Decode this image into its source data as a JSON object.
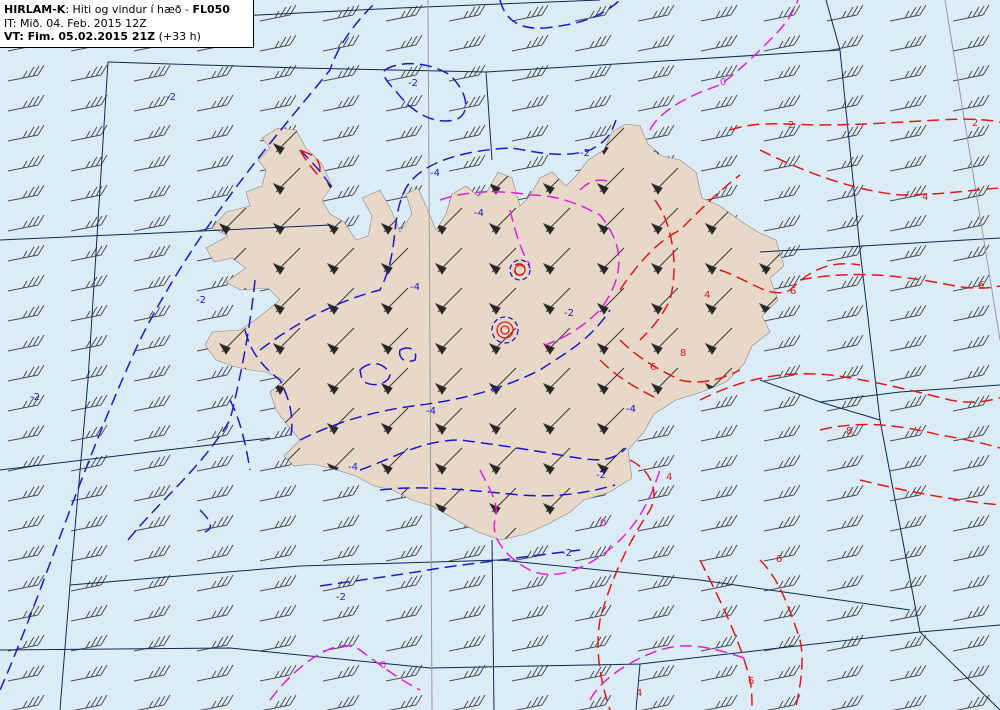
{
  "header": {
    "model": "HIRLAM-K",
    "description": ": Hiti og vindur í hæð - ",
    "level": "FL050",
    "issue_time": "IT: Mið. 04. Feb. 2015 12Z",
    "valid_prefix": "VT: Fim. 05.02.2015 21Z",
    "valid_offset": " (+33 h)"
  },
  "colors": {
    "sea": "#dcecf7",
    "land": "#e8d8c8",
    "negative_isotherm": "#1a1acc",
    "zero_isotherm": "#e21ee2",
    "positive_isotherm": "#e01818",
    "grid": "#0a2a55",
    "wind_barb": "#333333"
  },
  "contour_labels": {
    "minus2": "-2",
    "minus4": "-4",
    "zero": "0",
    "plus2": "2",
    "plus4": "4",
    "plus6": "6",
    "plus8": "8"
  },
  "icons": {
    "wind_barb": "wind-barb-icon"
  }
}
